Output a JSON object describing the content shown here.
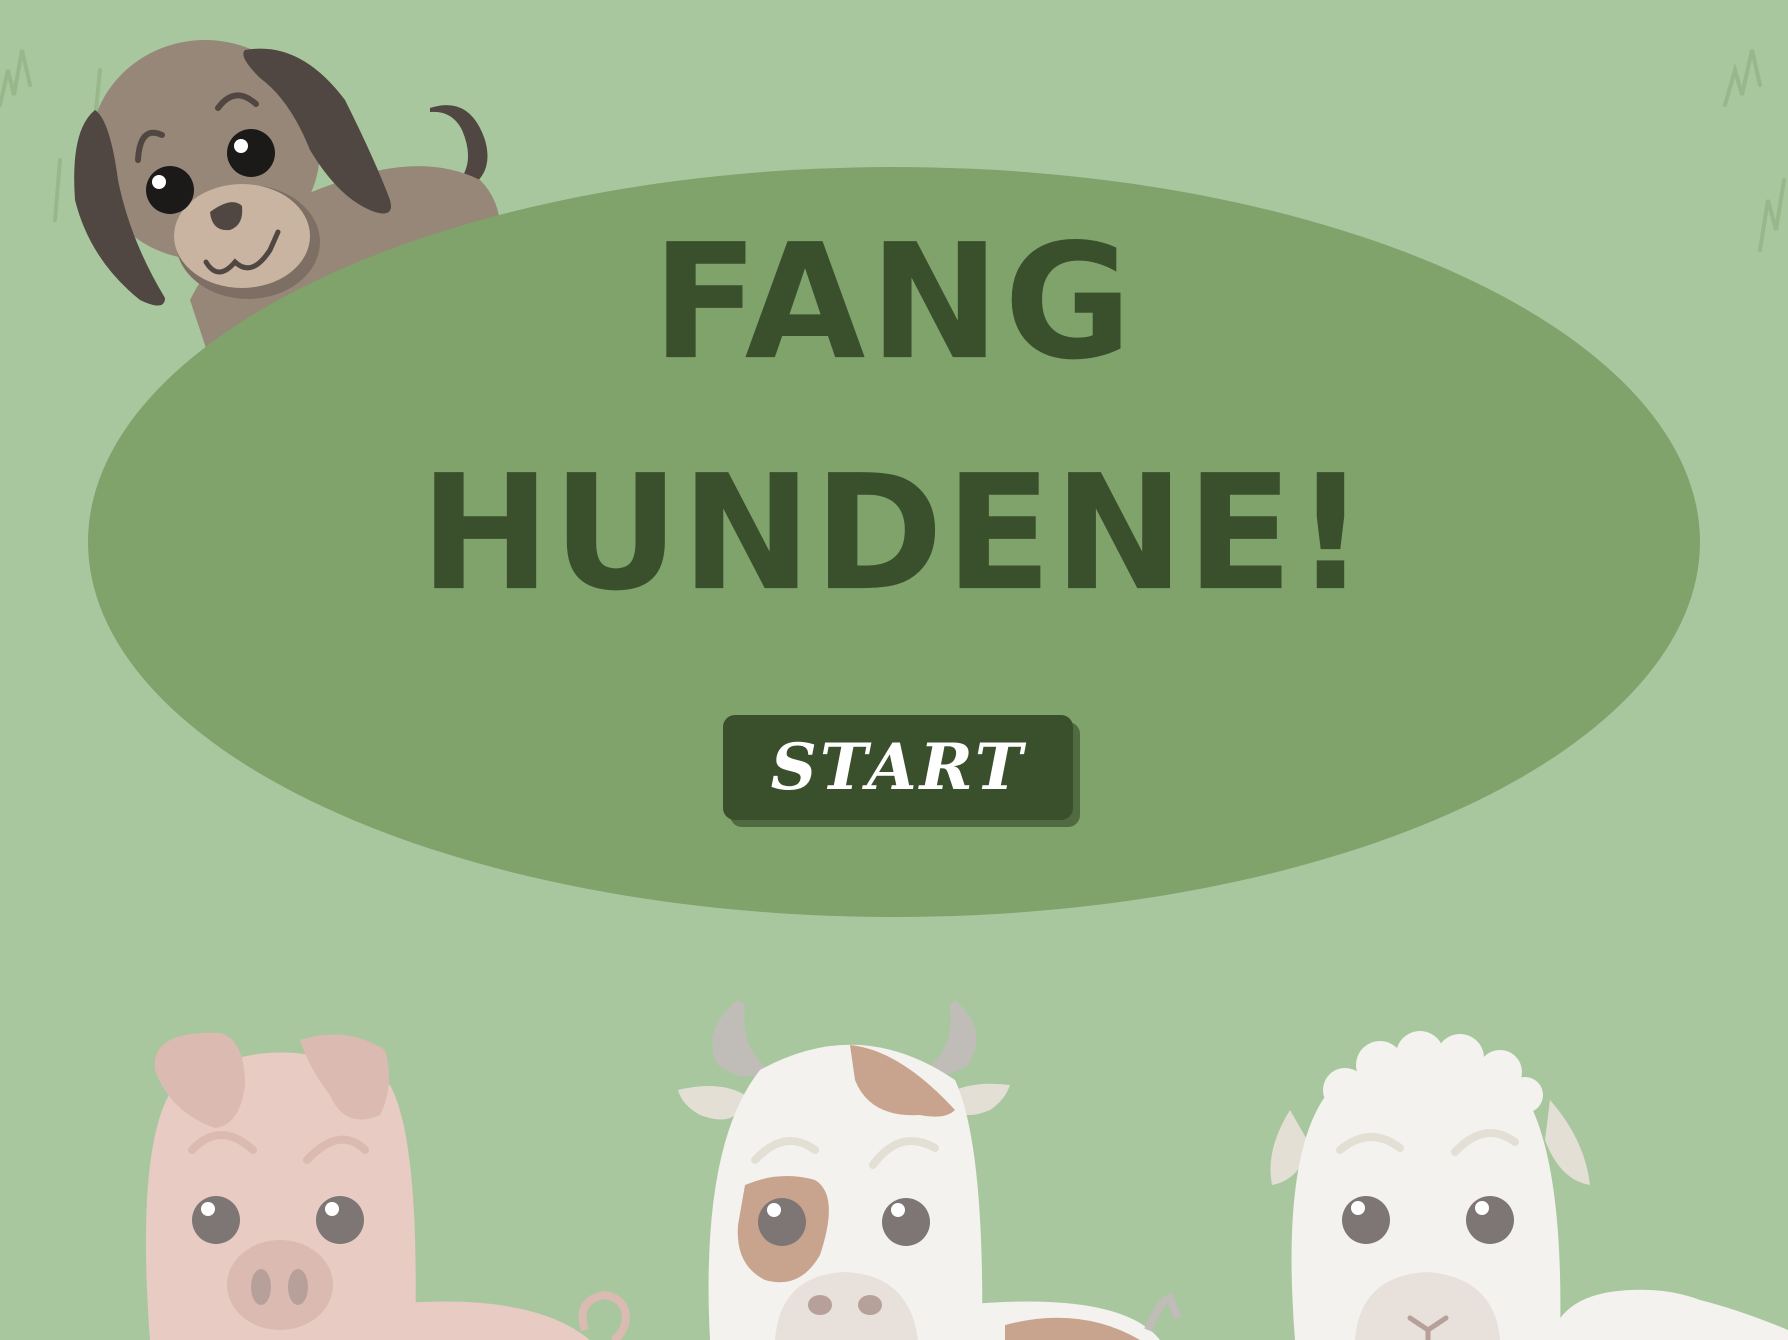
{
  "game": {
    "title_line_1": "FANG",
    "title_line_2": "HUNDENE!",
    "start_label": "START"
  },
  "colors": {
    "background": "#a9c79e",
    "panel": "#7fa36b",
    "title": "#3a502d",
    "button": "#3a502d",
    "button_text": "#ffffff",
    "dog_body": "#978778",
    "dog_ears": "#514742",
    "pig": "#e8cbc3",
    "cow": "#f3f2ee",
    "sheep": "#f3f2ee"
  },
  "characters": [
    {
      "name": "dog-icon"
    },
    {
      "name": "pig-icon"
    },
    {
      "name": "cow-icon"
    },
    {
      "name": "sheep-icon"
    }
  ]
}
